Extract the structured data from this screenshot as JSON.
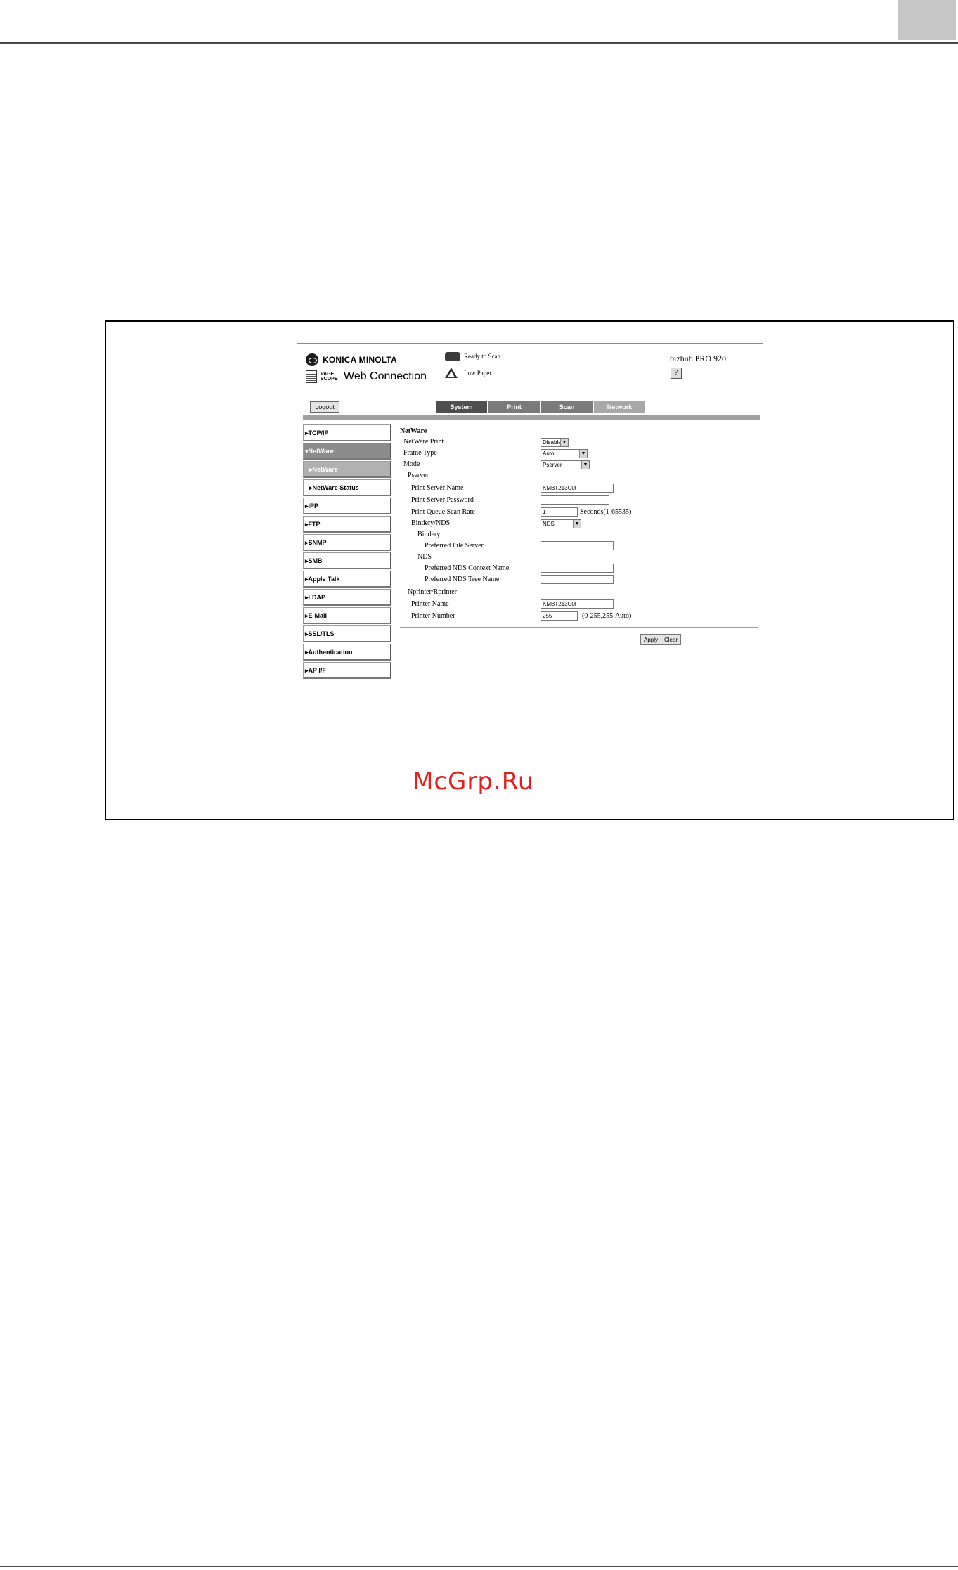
{
  "header": {
    "brand": "KONICA MINOLTA",
    "pagescope_line1": "PAGE",
    "pagescope_line2": "SCOPE",
    "web_connection": "Web Connection",
    "status_ready": "Ready to Scan",
    "status_paper": "Low Paper",
    "model": "bizhub PRO 920",
    "help_glyph": "?"
  },
  "toolbar": {
    "logout": "Logout",
    "tabs": [
      "System",
      "Print",
      "Scan",
      "Network"
    ]
  },
  "sidebar": {
    "items": [
      "▸TCP/IP",
      "▾NetWare",
      "▸NetWare",
      "▸NetWare Status",
      "▸IPP",
      "▸FTP",
      "▸SNMP",
      "▸SMB",
      "▸Apple Talk",
      "▸LDAP",
      "▸E-Mail",
      "▸SSL/TLS",
      "▸Authentication",
      "▸AP I/F"
    ]
  },
  "form": {
    "title": "NetWare",
    "netware_print_label": "NetWare Print",
    "netware_print_value": "Disable",
    "frame_type_label": "Frame Type",
    "frame_type_value": "Auto",
    "mode_label": "Mode",
    "mode_value": "Pserver",
    "pserver_heading": "Pserver",
    "print_server_name_label": "Print Server Name",
    "print_server_name_value": "KMBT213C0F",
    "print_server_password_label": "Print Server Password",
    "print_server_password_value": "",
    "scan_rate_label": "Print Queue Scan Rate",
    "scan_rate_value": "1",
    "scan_rate_hint": "Seconds(1-65535)",
    "bindery_nds_label": "Bindery/NDS",
    "bindery_nds_value": "NDS",
    "bindery_heading": "Bindery",
    "preferred_file_server_label": "Preferred File Server",
    "preferred_file_server_value": "",
    "nds_heading": "NDS",
    "nds_context_label": "Preferred NDS Context Name",
    "nds_context_value": "",
    "nds_tree_label": "Preferred NDS Tree Name",
    "nds_tree_value": "",
    "nprinter_heading": "Nprinter/Rprinter",
    "printer_name_label": "Printer Name",
    "printer_name_value": "KMBT213C0F",
    "printer_number_label": "Printer Number",
    "printer_number_value": "255",
    "printer_number_hint": "(0-255,255:Auto)",
    "apply": "Apply",
    "clear": "Clear",
    "dropdown_glyph": "▼"
  },
  "watermark": "McGrp.Ru"
}
